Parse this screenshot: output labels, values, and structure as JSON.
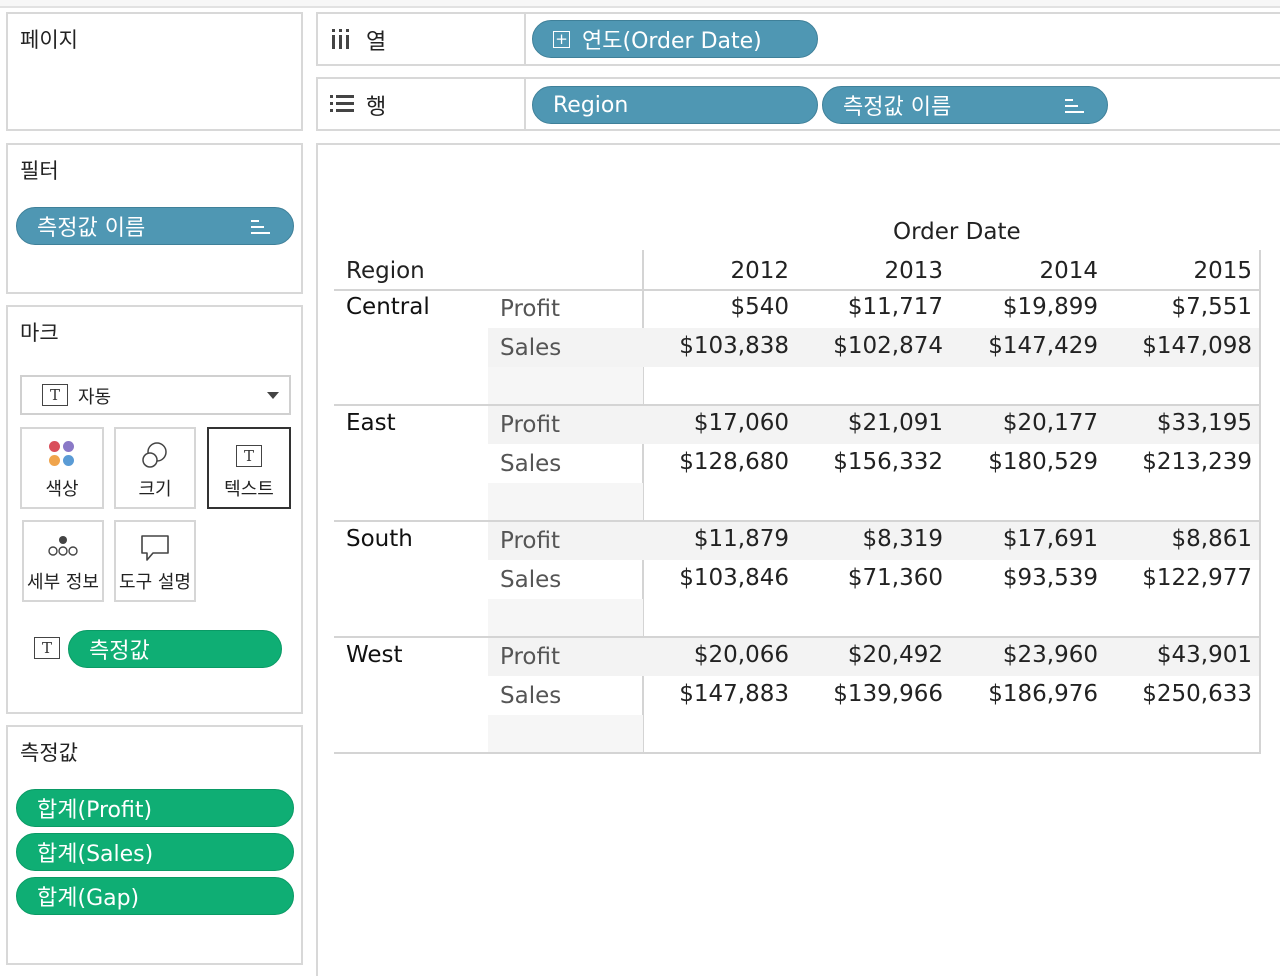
{
  "pages_panel": {
    "title": "페이지"
  },
  "filters_panel": {
    "title": "필터",
    "pill": "측정값 이름"
  },
  "marks_panel": {
    "title": "마크",
    "mark_type": "자동",
    "buttons": {
      "color": "색상",
      "size": "크기",
      "text": "텍스트",
      "detail": "세부 정보",
      "tooltip": "도구 설명"
    },
    "text_pill": "측정값"
  },
  "measure_values_panel": {
    "title": "측정값",
    "pills": [
      "합계(Profit)",
      "합계(Sales)",
      "합계(Gap)"
    ]
  },
  "columns_shelf": {
    "label": "열",
    "pill": "연도(Order Date)"
  },
  "rows_shelf": {
    "label": "행",
    "pills": [
      "Region",
      "측정값 이름"
    ]
  },
  "colors": {
    "blue_pill": "#4f97b3",
    "green_pill": "#0fae74"
  },
  "table": {
    "column_group_header": "Order Date",
    "row_header": "Region",
    "years": [
      "2012",
      "2013",
      "2014",
      "2015"
    ],
    "regions": [
      {
        "name": "Central",
        "rows": [
          {
            "measure": "Profit",
            "values": [
              "$540",
              "$11,717",
              "$19,899",
              "$7,551"
            ]
          },
          {
            "measure": "Sales",
            "values": [
              "$103,838",
              "$102,874",
              "$147,429",
              "$147,098"
            ]
          }
        ]
      },
      {
        "name": "East",
        "rows": [
          {
            "measure": "Profit",
            "values": [
              "$17,060",
              "$21,091",
              "$20,177",
              "$33,195"
            ]
          },
          {
            "measure": "Sales",
            "values": [
              "$128,680",
              "$156,332",
              "$180,529",
              "$213,239"
            ]
          }
        ]
      },
      {
        "name": "South",
        "rows": [
          {
            "measure": "Profit",
            "values": [
              "$11,879",
              "$8,319",
              "$17,691",
              "$8,861"
            ]
          },
          {
            "measure": "Sales",
            "values": [
              "$103,846",
              "$71,360",
              "$93,539",
              "$122,977"
            ]
          }
        ]
      },
      {
        "name": "West",
        "rows": [
          {
            "measure": "Profit",
            "values": [
              "$20,066",
              "$20,492",
              "$23,960",
              "$43,901"
            ]
          },
          {
            "measure": "Sales",
            "values": [
              "$147,883",
              "$139,966",
              "$186,976",
              "$250,633"
            ]
          }
        ]
      }
    ]
  }
}
